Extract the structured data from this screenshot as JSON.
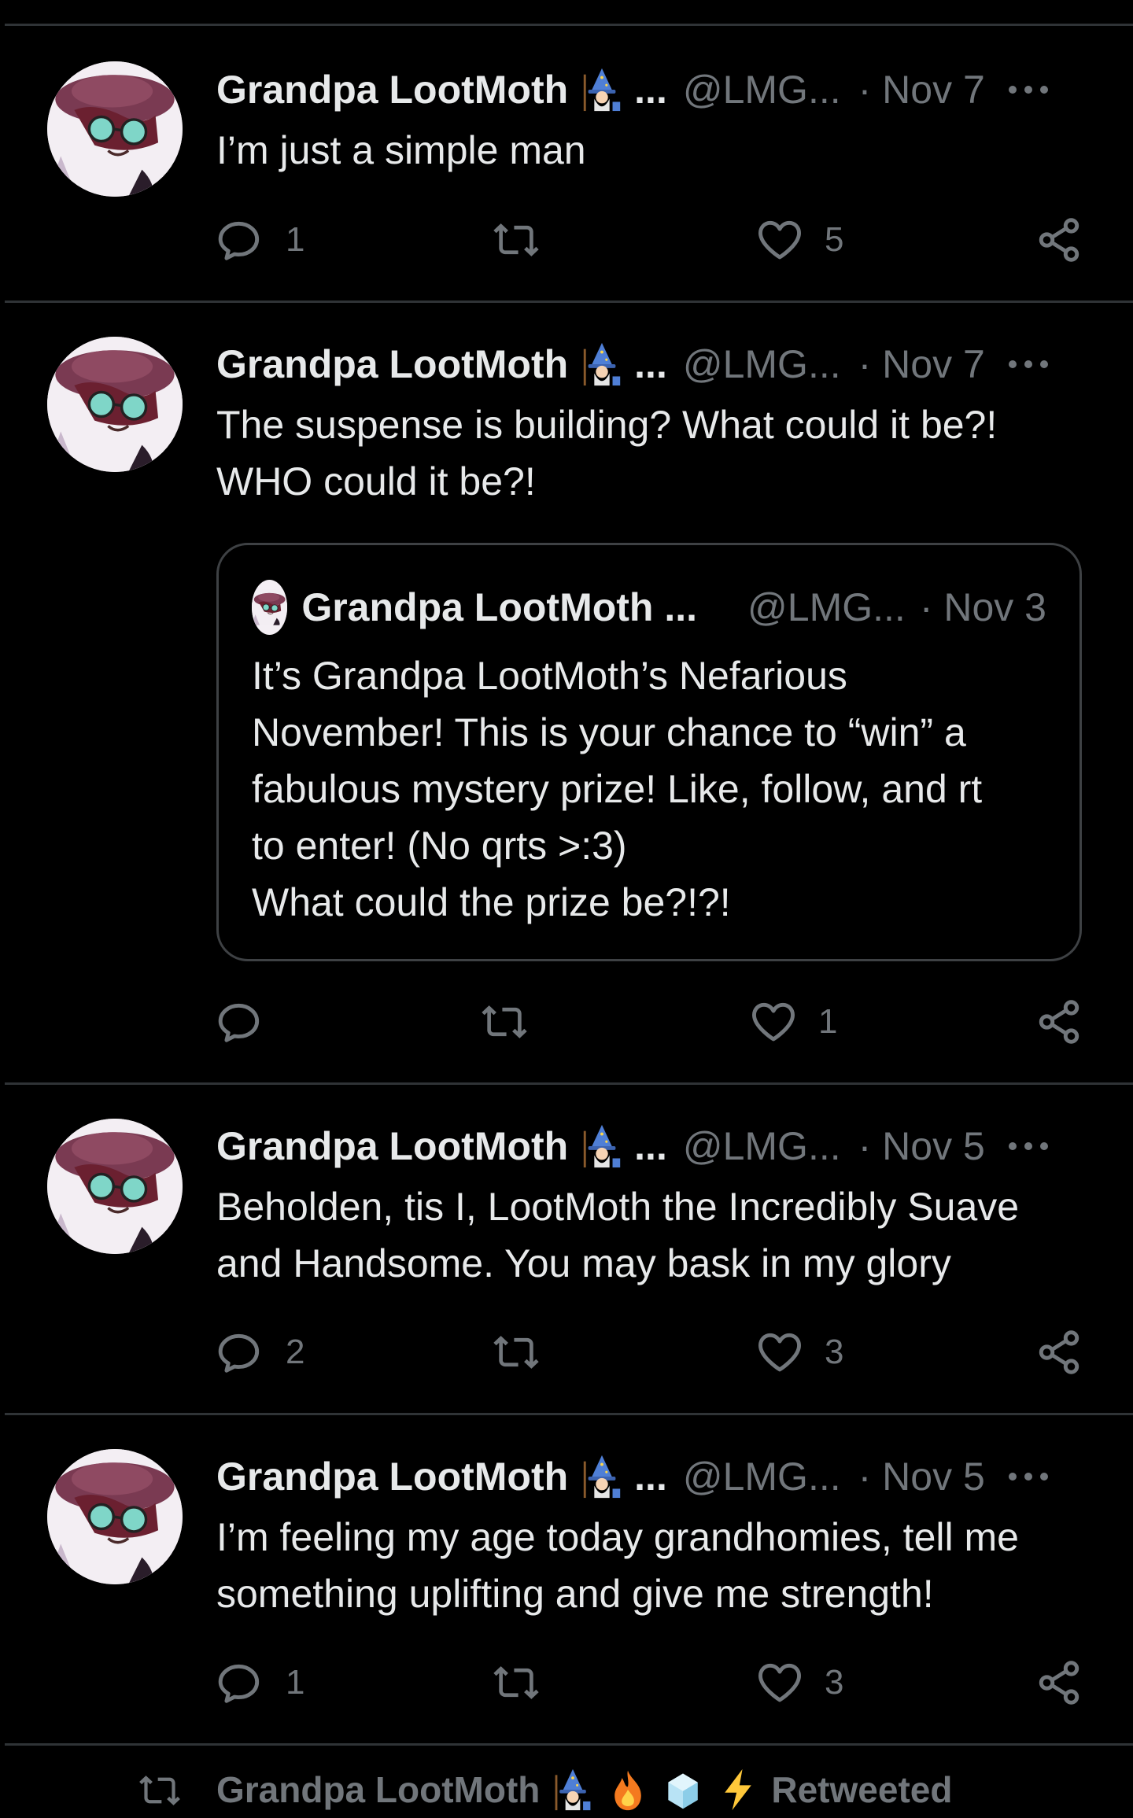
{
  "tweets": [
    {
      "name": "Grandpa LootMoth",
      "name_suffix": "...",
      "handle": "@LMG...",
      "date": "· Nov 7",
      "text": "I’m just a simple man",
      "reply_count": "1",
      "retweet_count": "",
      "like_count": "5"
    },
    {
      "name": "Grandpa LootMoth",
      "name_suffix": "...",
      "handle": "@LMG...",
      "date": "· Nov 7",
      "text": "The suspense is building? What could it be?!\nWHO could it be?!",
      "reply_count": "",
      "retweet_count": "",
      "like_count": "1",
      "quote": {
        "name": "Grandpa LootMoth ...",
        "handle": "@LMG...",
        "date": "· Nov 3",
        "text": "It’s Grandpa LootMoth’s Nefarious\nNovember! This is your chance to “win” a\nfabulous mystery prize! Like, follow, and rt\nto enter! (No qrts >:3)\nWhat could the prize be?!?!"
      }
    },
    {
      "name": "Grandpa LootMoth",
      "name_suffix": "...",
      "handle": "@LMG...",
      "date": "· Nov 5",
      "text": "Beholden, tis I, LootMoth the Incredibly Suave\nand Handsome. You may bask in my glory",
      "reply_count": "2",
      "retweet_count": "",
      "like_count": "3"
    },
    {
      "name": "Grandpa LootMoth",
      "name_suffix": "...",
      "handle": "@LMG...",
      "date": "· Nov 5",
      "text": "I’m feeling my age today grandhomies, tell me\nsomething uplifting and give me strength!",
      "reply_count": "1",
      "retweet_count": "",
      "like_count": "3"
    }
  ],
  "retweet_banner": {
    "name": "Grandpa LootMoth",
    "label": "Retweeted",
    "emojis": [
      "wizard-emoji",
      "fire-emoji",
      "ice-emoji",
      "lightning-emoji"
    ]
  },
  "colors": {
    "background": "#000000",
    "text": "#e7e9ea",
    "muted": "#71767b",
    "divider": "#2f3336"
  }
}
